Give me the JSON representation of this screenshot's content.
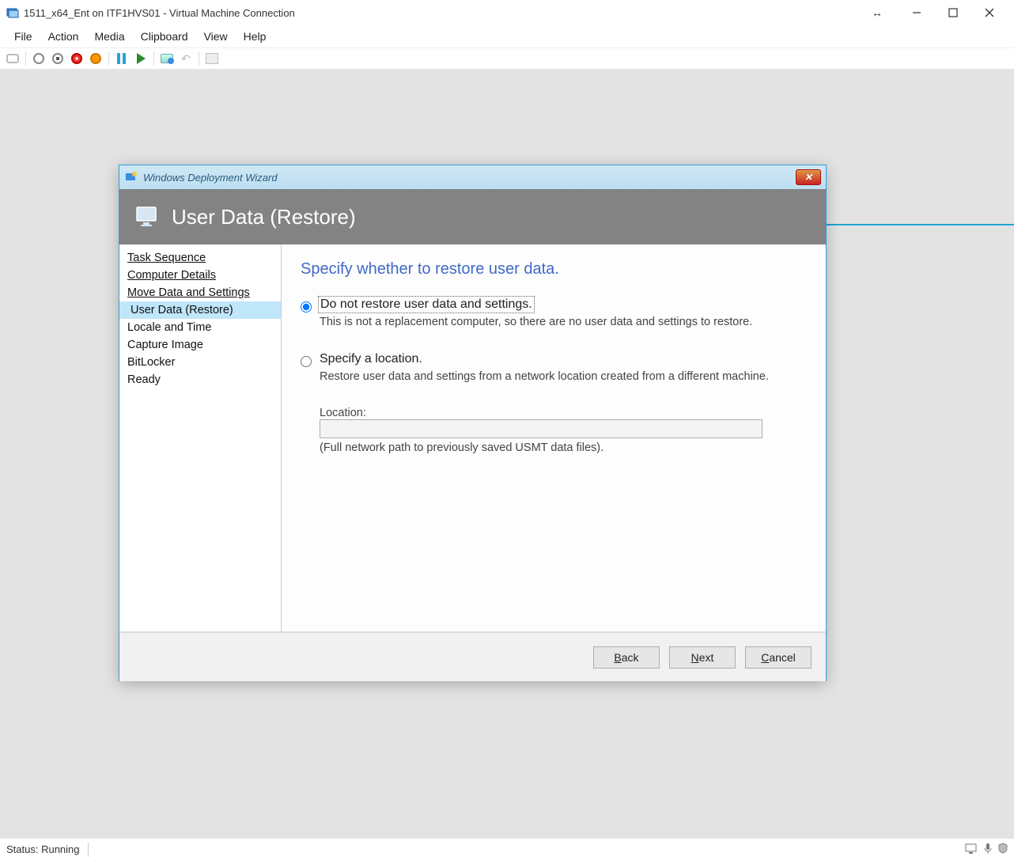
{
  "window": {
    "title": "1511_x64_Ent on ITF1HVS01 - Virtual Machine Connection"
  },
  "menubar": {
    "items": [
      "File",
      "Action",
      "Media",
      "Clipboard",
      "View",
      "Help"
    ]
  },
  "wizard": {
    "title": "Windows Deployment Wizard",
    "header": "User Data (Restore)",
    "nav": [
      {
        "label": "Task Sequence",
        "link": true
      },
      {
        "label": "Computer Details",
        "link": true
      },
      {
        "label": "Move Data and Settings",
        "link": true
      },
      {
        "label": "User Data (Restore)",
        "selected": true
      },
      {
        "label": "Locale and Time"
      },
      {
        "label": "Capture Image"
      },
      {
        "label": "BitLocker"
      },
      {
        "label": "Ready"
      }
    ],
    "content": {
      "heading": "Specify whether to restore user data.",
      "option1_label": "Do not restore user data and settings.",
      "option1_desc": "This is not a replacement computer, so there are no user data and settings to restore.",
      "option2_label": "Specify a location.",
      "option2_desc": "Restore user data and settings from a network location created from a different machine.",
      "location_label": "Location:",
      "location_value": "",
      "location_hint": "(Full network path to previously saved USMT data files)."
    },
    "buttons": {
      "back": "Back",
      "next": "Next",
      "cancel": "Cancel"
    }
  },
  "statusbar": {
    "text": "Status: Running"
  }
}
